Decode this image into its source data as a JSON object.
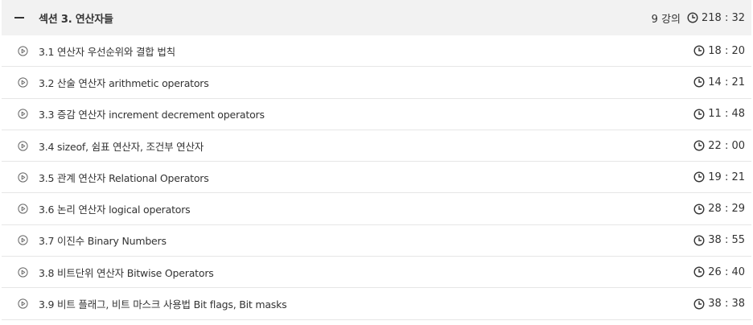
{
  "section": {
    "title": "섹션 3. 연산자들",
    "lecture_count": "9 강의",
    "total_duration": "218 : 32",
    "collapse_icon": "minus-icon",
    "clock_icon": "clock-icon"
  },
  "lectures": [
    {
      "title": "3.1 연산자 우선순위와 결합 법칙",
      "duration": "18 : 20"
    },
    {
      "title": "3.2 산술 연산자 arithmetic operators",
      "duration": "14 : 21"
    },
    {
      "title": "3.3 증감 연산자 increment decrement operators",
      "duration": "11 : 48"
    },
    {
      "title": "3.4 sizeof, 쉼표 연산자, 조건부 연산자",
      "duration": "22 : 00"
    },
    {
      "title": "3.5 관계 연산자 Relational Operators",
      "duration": "19 : 21"
    },
    {
      "title": "3.6 논리 연산자 logical operators",
      "duration": "28 : 29"
    },
    {
      "title": "3.7 이진수 Binary Numbers",
      "duration": "38 : 55"
    },
    {
      "title": "3.8 비트단위 연산자 Bitwise Operators",
      "duration": "26 : 40"
    },
    {
      "title": "3.9 비트 플래그, 비트 마스크 사용법 Bit flags, Bit masks",
      "duration": "38 : 38"
    }
  ],
  "colors": {
    "header_bg": "#f2f2f2",
    "text": "#333333",
    "divider": "#e6e6e6"
  }
}
